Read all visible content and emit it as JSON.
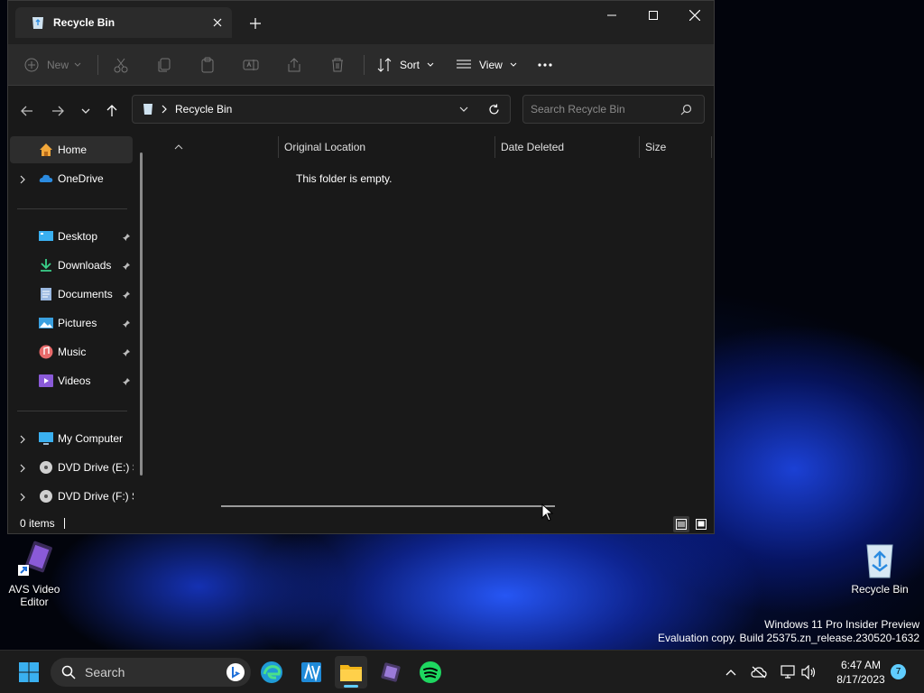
{
  "desktop": {
    "icons": [
      {
        "label": "AVS Video Editor",
        "icon": "avs-video-editor-icon"
      },
      {
        "label": "Recycle Bin",
        "icon": "recycle-bin-icon"
      }
    ],
    "watermark": {
      "line1": "Windows 11 Pro Insider Preview",
      "line2": "Evaluation copy. Build 25375.zn_release.230520-1632"
    }
  },
  "window": {
    "tab_title": "Recycle Bin",
    "toolbar": {
      "new_label": "New",
      "sort_label": "Sort",
      "view_label": "View"
    },
    "address": {
      "path": [
        "Recycle Bin"
      ]
    },
    "search": {
      "placeholder": "Search Recycle Bin"
    },
    "sidebar": {
      "items": [
        {
          "label": "Home",
          "icon": "home-icon",
          "expandable": false,
          "pinned": false,
          "active": true
        },
        {
          "label": "OneDrive",
          "icon": "onedrive-icon",
          "expandable": true,
          "pinned": false
        },
        {
          "label": "Desktop",
          "icon": "desktop-icon",
          "expandable": false,
          "pinned": true
        },
        {
          "label": "Downloads",
          "icon": "downloads-icon",
          "expandable": false,
          "pinned": true
        },
        {
          "label": "Documents",
          "icon": "documents-icon",
          "expandable": false,
          "pinned": true
        },
        {
          "label": "Pictures",
          "icon": "pictures-icon",
          "expandable": false,
          "pinned": true
        },
        {
          "label": "Music",
          "icon": "music-icon",
          "expandable": false,
          "pinned": true
        },
        {
          "label": "Videos",
          "icon": "videos-icon",
          "expandable": false,
          "pinned": true
        },
        {
          "label": "My Computer",
          "icon": "computer-icon",
          "expandable": true,
          "pinned": false
        },
        {
          "label": "DVD Drive (E:) Sa",
          "icon": "dvd-drive-icon",
          "expandable": true,
          "pinned": false
        },
        {
          "label": "DVD Drive (F:) Sa",
          "icon": "dvd-drive-icon",
          "expandable": true,
          "pinned": false
        }
      ]
    },
    "columns": [
      "Original Location",
      "Date Deleted",
      "Size"
    ],
    "empty_message": "This folder is empty.",
    "status": {
      "item_count": "0 items"
    }
  },
  "taskbar": {
    "search_label": "Search",
    "apps": [
      "start-icon",
      "edge-icon",
      "avs-icon",
      "file-explorer-icon",
      "video-app-icon",
      "spotify-icon"
    ],
    "clock": {
      "time": "6:47 AM",
      "date": "8/17/2023"
    },
    "notification_count": "7"
  },
  "colors": {
    "accent": "#60cdff",
    "window_bg": "#191919",
    "toolbar_bg": "#2b2b2b",
    "taskbar_bg": "#1c1c1c"
  }
}
